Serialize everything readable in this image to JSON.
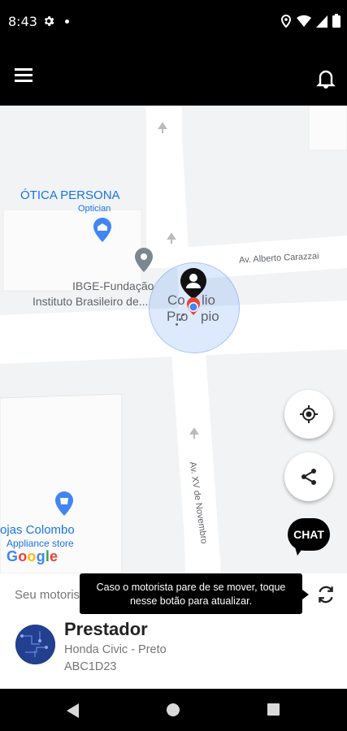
{
  "status_bar": {
    "time": "8:43"
  },
  "map": {
    "pois": [
      {
        "name": "ÓTICA PERSONA",
        "category": "Optician"
      },
      {
        "name": "IBGE-Fundação",
        "subtitle": "Instituto Brasileiro de..."
      },
      {
        "name": "Colégio Procópio"
      },
      {
        "name": "ojas Colombo",
        "category": "Appliance store"
      }
    ],
    "streets": [
      "Av. Alberto Carazzai",
      "Av. XV de Novembro"
    ],
    "attribution": "Google"
  },
  "chat_label": "CHAT",
  "driver_panel": {
    "label": "Seu motorista",
    "tooltip_line1": "Caso o motorista pare de se mover, toque",
    "tooltip_line2": "nesse botão para atualizar."
  },
  "provider": {
    "name": "Prestador",
    "car": "Honda Civic - Preto",
    "plate": "ABC1D23"
  },
  "colors": {
    "accent": "#1a73e8",
    "pin": "#ea4335",
    "map_bg": "#f1f3f4"
  }
}
